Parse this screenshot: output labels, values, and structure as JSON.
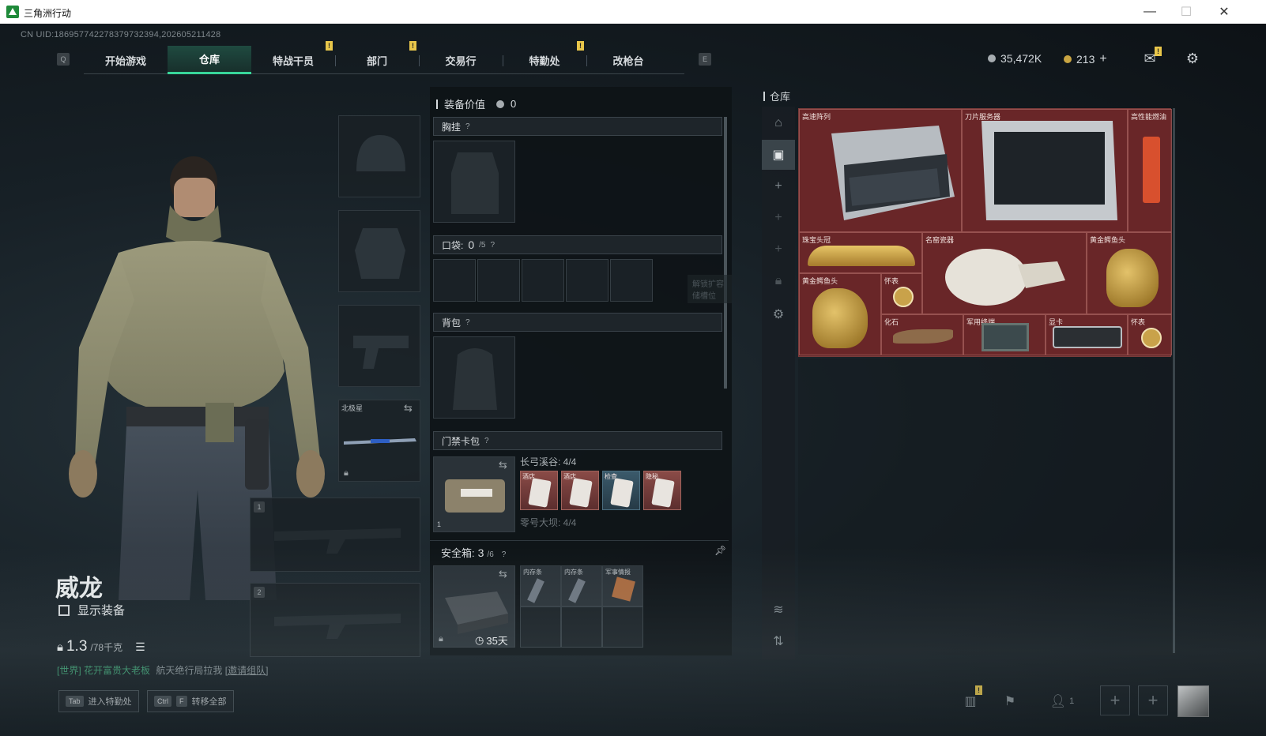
{
  "window": {
    "title": "三角洲行动",
    "minimize": "—",
    "maximize": "☐",
    "close": "✕"
  },
  "uid": "CN UID:18695774227837973239​4,202605211428",
  "tabs": {
    "left_key": "Q",
    "right_key": "E",
    "items": [
      {
        "label": "开始游戏",
        "badge": ""
      },
      {
        "label": "仓库",
        "badge": ""
      },
      {
        "label": "特战干员",
        "badge": "!"
      },
      {
        "label": "部门",
        "badge": "!"
      },
      {
        "label": "交易行",
        "badge": ""
      },
      {
        "label": "特勤处",
        "badge": "!"
      },
      {
        "label": "改枪台",
        "badge": ""
      }
    ],
    "active": 1
  },
  "currency": {
    "silver": "35,472K",
    "gold": "213",
    "plus": "+"
  },
  "top_icons": {
    "mail_badge": "!",
    "mail_icon": "mail-icon",
    "settings_icon": "gear-icon"
  },
  "operator": {
    "name": "威龙",
    "show_equipment": "显示装备",
    "weight_value": "1.3",
    "weight_max": "/78千克"
  },
  "chat": {
    "channel": "[世界]",
    "sender": "花开富贵大老板",
    "message": "航天绝行局拉我",
    "invite": "[邀请组队]"
  },
  "equip_slots": {
    "weapon_label": "北极星",
    "slot1": "1",
    "slot2": "2"
  },
  "equipment": {
    "value_label": "装备价值",
    "value": "0",
    "chest": "胸挂",
    "chest_q": "?",
    "pocket": "口袋:",
    "pocket_count": "0",
    "pocket_max": "/5",
    "pocket_q": "?",
    "pocket_hint": "解锁扩容储槽位",
    "backpack": "背包",
    "backpack_q": "?",
    "keycard": "门禁卡包",
    "keycard_q": "?",
    "keycard_set1": "长弓溪谷: 4/4",
    "keycard_set2": "零号大坝: 4/4",
    "keycard_slot_num": "1",
    "cards": [
      "酒店",
      "酒店",
      "检查",
      "隐秘"
    ],
    "safe": "安全箱:",
    "safe_count": "3",
    "safe_max": "/6",
    "safe_q": "?",
    "safe_days": "35天",
    "safe_items": [
      "内存条",
      "内存条",
      "军事情报"
    ]
  },
  "warehouse": {
    "title": "仓库",
    "items": [
      {
        "label": "高速阵列"
      },
      {
        "label": "刀片服务器"
      },
      {
        "label": "高性能燃油"
      },
      {
        "label": "珠宝头冠"
      },
      {
        "label": "名窑瓷器"
      },
      {
        "label": "黄金鳄鱼头"
      },
      {
        "label": "黄金鳄鱼头"
      },
      {
        "label": "怀表"
      },
      {
        "label": "化石"
      },
      {
        "label": "军用终端"
      },
      {
        "label": "显卡"
      },
      {
        "label": "怀表"
      }
    ]
  },
  "bottom": {
    "btn1_key": "Tab",
    "btn1_label": "进入特勤处",
    "btn2_key1": "Ctrl",
    "btn2_key2": "F",
    "btn2_label": "转移全部",
    "stats_badge": "!",
    "friends_count": "1"
  }
}
